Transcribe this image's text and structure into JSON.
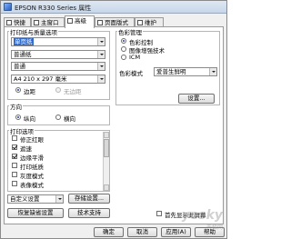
{
  "window": {
    "title": "EPSON R330 Series 属性"
  },
  "tabs": [
    {
      "label": "快捷"
    },
    {
      "label": "主窗口"
    },
    {
      "label": "高级"
    },
    {
      "label": "页面版式"
    },
    {
      "label": "维护"
    }
  ],
  "paper_quality": {
    "group_label": "打印纸与质量选项",
    "source": "单页纸",
    "type": "普通纸",
    "quality": "普通",
    "size": "A4 210 x 297 毫米",
    "borderless_label": "边距",
    "borderless_alt_label": "无边距",
    "margin_selected": true
  },
  "orientation": {
    "group_label": "方向",
    "portrait_label": "纵向",
    "landscape_label": "横向",
    "portrait_selected": true
  },
  "print_options": {
    "group_label": "打印选项",
    "items": [
      {
        "label": "修正红眼",
        "checked": false
      },
      {
        "label": "遮速",
        "checked": true
      },
      {
        "label": "边缘平滑",
        "checked": true
      },
      {
        "label": "打印纸质",
        "checked": false
      },
      {
        "label": "灰度模式",
        "checked": false
      },
      {
        "label": "表像模式",
        "checked": false
      }
    ]
  },
  "color_management": {
    "group_label": "色彩管理",
    "options": [
      {
        "label": "色彩控制",
        "selected": true
      },
      {
        "label": "图像增强技术",
        "selected": false
      },
      {
        "label": "ICM",
        "selected": false
      }
    ],
    "mode_label": "色彩模式",
    "mode_value": "爱普生鲜明",
    "settings_button": "设置..."
  },
  "bottom": {
    "custom_select": "自定义设置",
    "save_settings_button": "存储设置...",
    "restore_defaults_button": "恢复缺省设置",
    "tech_support_button": "技术支持",
    "show_first_label": "首先显示此屏幕",
    "show_first_checked": false
  },
  "dialog_buttons": {
    "ok": "确定",
    "cancel": "取消",
    "apply": "应用(A)",
    "help": "帮助"
  },
  "watermark": {
    "main": "yesky",
    "sub": "天极网"
  }
}
